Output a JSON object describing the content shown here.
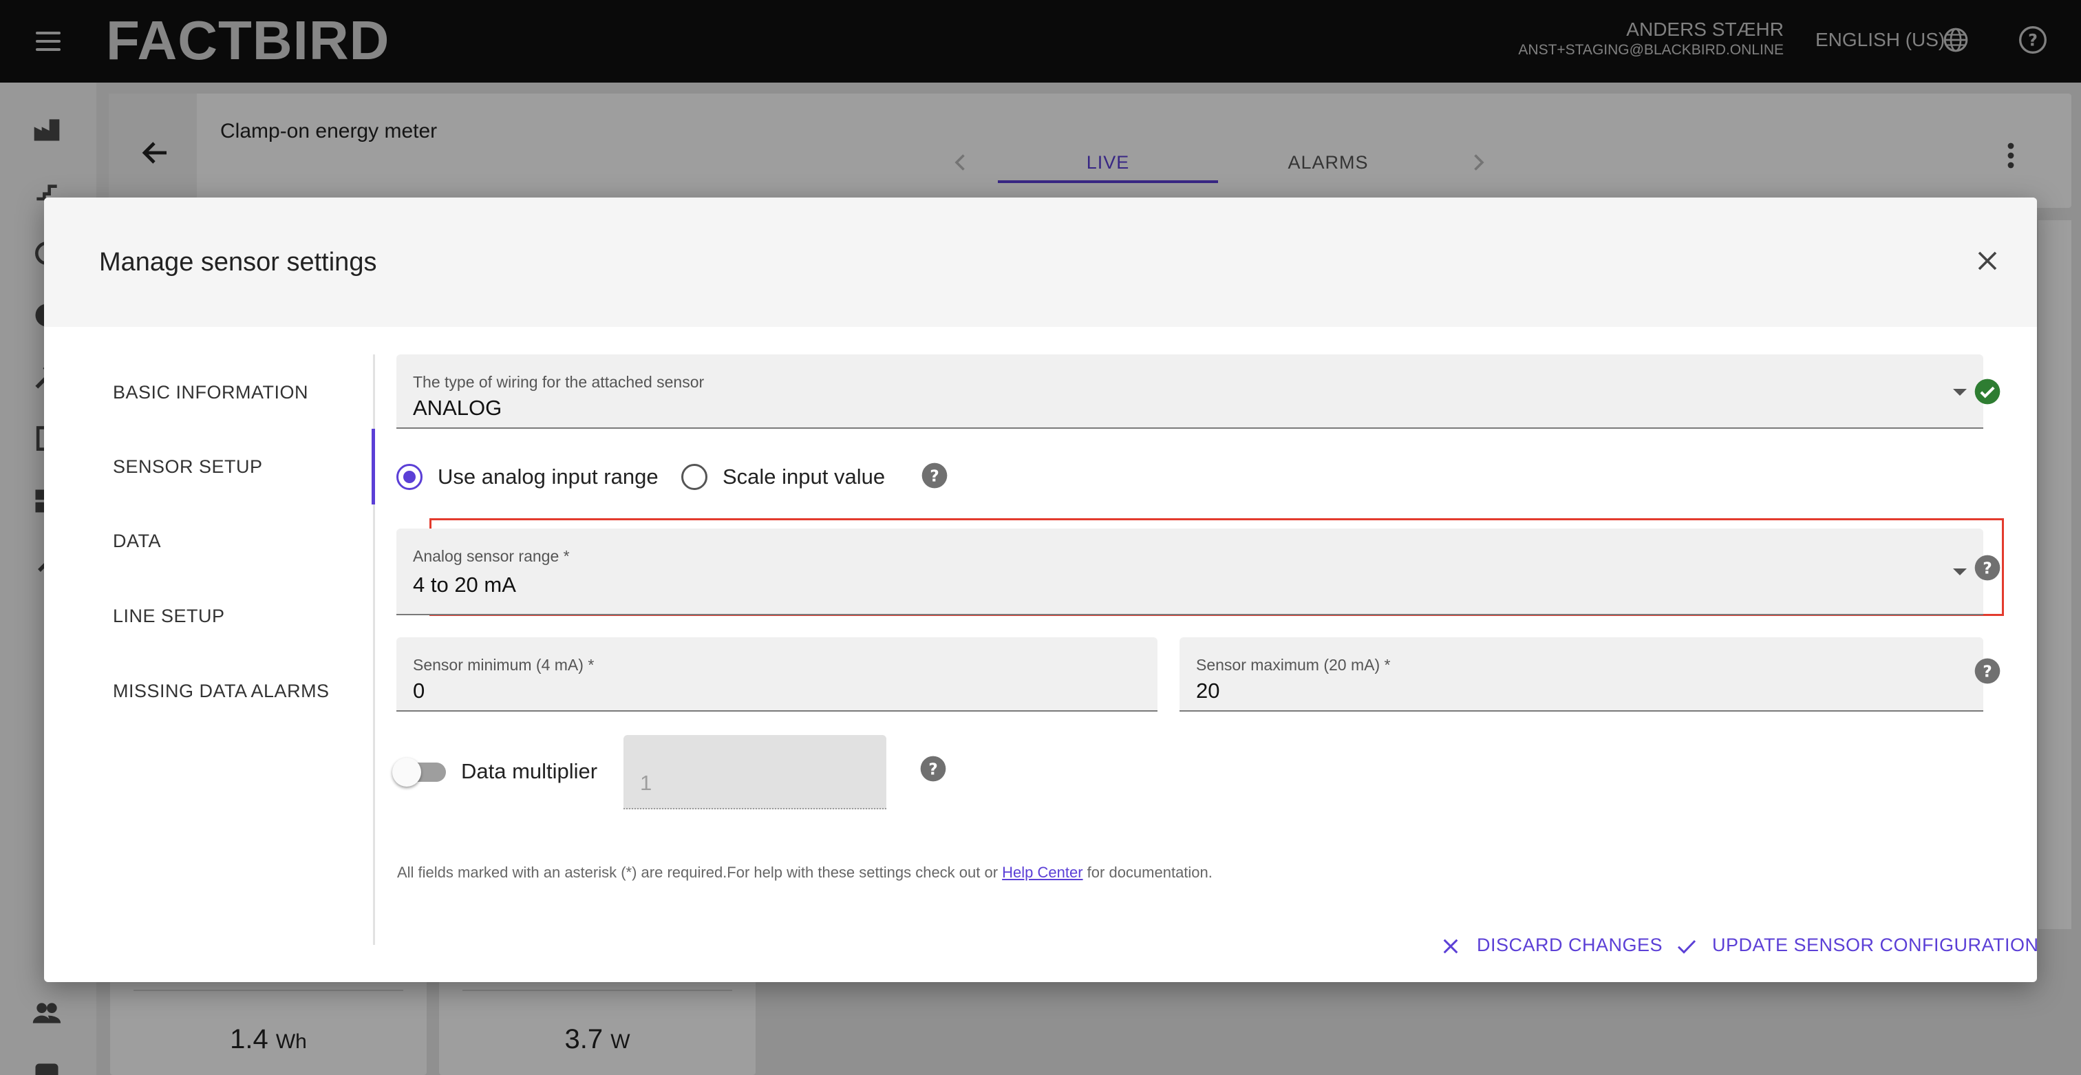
{
  "appbar": {
    "logo": "FACTBIRD",
    "user_name": "ANDERS STÆHR",
    "user_email": "ANST+STAGING@BLACKBIRD.ONLINE",
    "language": "ENGLISH (US)"
  },
  "page": {
    "title": "Clamp-on energy meter",
    "tabs": [
      {
        "label": "LIVE",
        "active": true
      },
      {
        "label": "ALARMS",
        "active": false
      }
    ],
    "cards": [
      {
        "value": "1.4",
        "unit": "Wh"
      },
      {
        "value": "3.7",
        "unit": "W"
      }
    ]
  },
  "dialog": {
    "title": "Manage sensor settings",
    "nav": [
      {
        "label": "BASIC INFORMATION",
        "active": false
      },
      {
        "label": "SENSOR SETUP",
        "active": true
      },
      {
        "label": "DATA",
        "active": false
      },
      {
        "label": "LINE SETUP",
        "active": false
      },
      {
        "label": "MISSING DATA ALARMS",
        "active": false
      }
    ],
    "wiring": {
      "label": "The type of wiring for the attached sensor",
      "value": "ANALOG"
    },
    "radios": [
      {
        "label": "Use analog input range",
        "selected": true
      },
      {
        "label": "Scale input value",
        "selected": false
      }
    ],
    "range": {
      "label": "Analog sensor range *",
      "value": "4 to 20 mA"
    },
    "sensor_min": {
      "label": "Sensor minimum (4 mA) *",
      "value": "0"
    },
    "sensor_max": {
      "label": "Sensor maximum (20 mA) *",
      "value": "20"
    },
    "multiplier": {
      "label": "Data multiplier",
      "enabled": false,
      "value": "1"
    },
    "footnote": {
      "text": "All fields marked with an asterisk (*) are required.For help with these settings check out or ",
      "link": "Help Center",
      "suffix": " for documentation."
    },
    "actions": {
      "discard": "DISCARD CHANGES",
      "update": "UPDATE SENSOR CONFIGURATION"
    }
  },
  "colors": {
    "accent": "#5b3fd6",
    "success": "#2e7d32",
    "highlight": "#e33b2e"
  }
}
